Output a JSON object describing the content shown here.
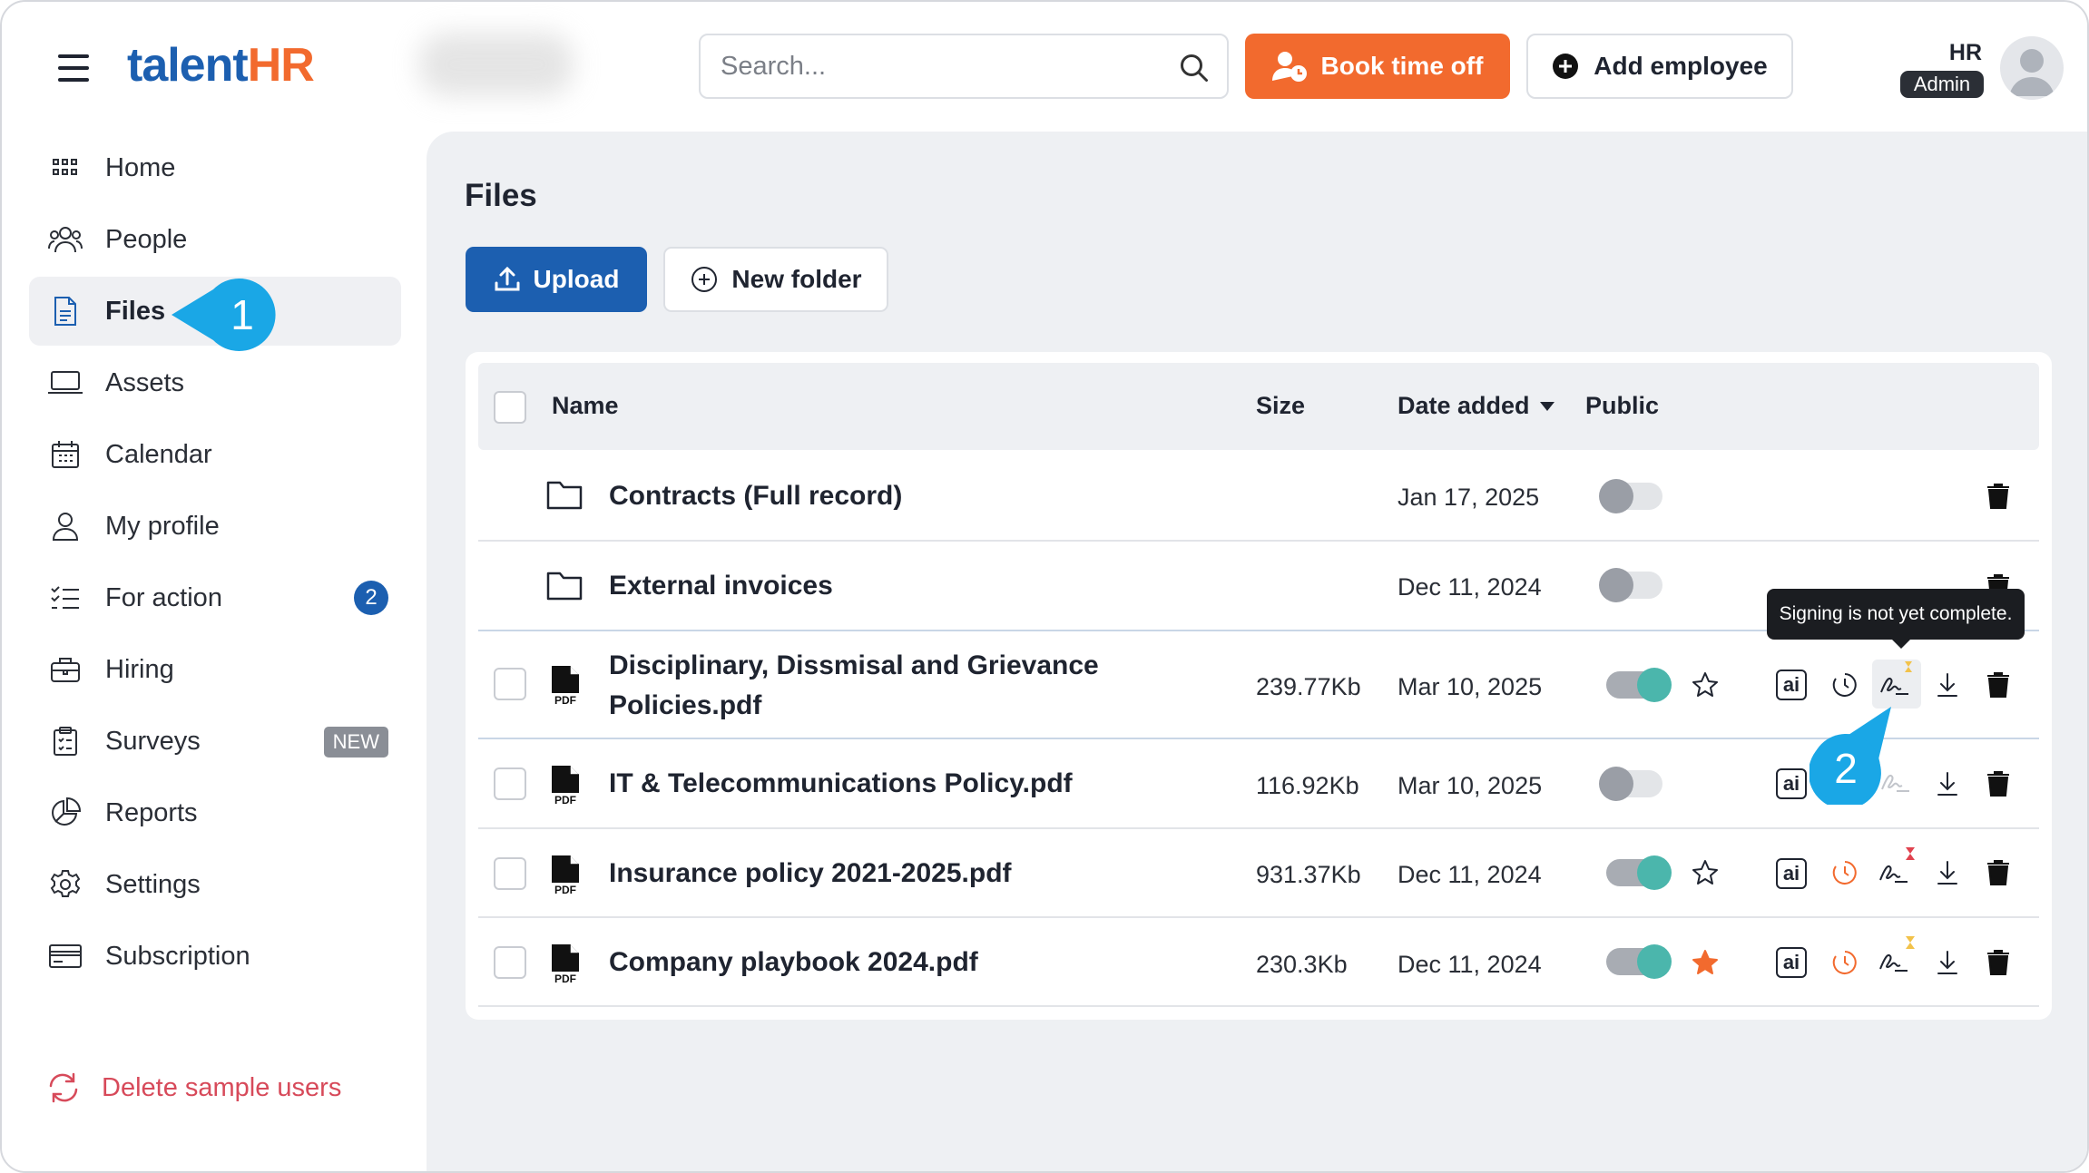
{
  "header": {
    "logo_talent": "talent",
    "logo_hr": "HR",
    "search_placeholder": "Search...",
    "book_time_off": "Book time off",
    "add_employee": "Add employee",
    "user_role_top": "HR",
    "user_role_badge": "Admin"
  },
  "sidebar": {
    "items": [
      {
        "label": "Home",
        "icon": "grid-icon"
      },
      {
        "label": "People",
        "icon": "people-icon"
      },
      {
        "label": "Files",
        "icon": "file-icon",
        "active": true
      },
      {
        "label": "Assets",
        "icon": "laptop-icon"
      },
      {
        "label": "Calendar",
        "icon": "calendar-icon"
      },
      {
        "label": "My profile",
        "icon": "person-icon"
      },
      {
        "label": "For action",
        "icon": "checklist-icon",
        "badge": "2"
      },
      {
        "label": "Hiring",
        "icon": "briefcase-icon"
      },
      {
        "label": "Surveys",
        "icon": "clipboard-icon",
        "tag": "NEW"
      },
      {
        "label": "Reports",
        "icon": "pie-chart-icon"
      },
      {
        "label": "Settings",
        "icon": "gear-icon"
      },
      {
        "label": "Subscription",
        "icon": "card-icon"
      }
    ],
    "delete_sample_users": "Delete sample users"
  },
  "main": {
    "title": "Files",
    "upload_label": "Upload",
    "new_folder_label": "New folder",
    "columns": {
      "name": "Name",
      "size": "Size",
      "date_added": "Date added",
      "public": "Public"
    },
    "rows": [
      {
        "type": "folder",
        "name": "Contracts (Full record)",
        "size": "",
        "date": "Jan 17, 2025",
        "public": false
      },
      {
        "type": "folder",
        "name": "External invoices",
        "size": "",
        "date": "Dec 11, 2024",
        "public": false
      },
      {
        "type": "pdf",
        "name_line1": "Disciplinary, Dissmisal and Grievance",
        "name_line2": "Policies.pdf",
        "size": "239.77Kb",
        "date": "Mar 10, 2025",
        "public": true,
        "starred": false,
        "sign_status": "pending"
      },
      {
        "type": "pdf",
        "name": "IT & Telecommunications Policy.pdf",
        "size": "116.92Kb",
        "date": "Mar 10, 2025",
        "public": false,
        "sign_status": "none"
      },
      {
        "type": "pdf",
        "name": "Insurance policy 2021-2025.pdf",
        "size": "931.37Kb",
        "date": "Dec 11, 2024",
        "public": true,
        "starred": false,
        "sign_status": "expired"
      },
      {
        "type": "pdf",
        "name": "Company playbook 2024.pdf",
        "size": "230.3Kb",
        "date": "Dec 11, 2024",
        "public": true,
        "starred": true,
        "sign_status": "pending"
      }
    ],
    "tooltip": "Signing is not yet complete.",
    "pdf_label": "PDF",
    "ai_label": "ai"
  },
  "callouts": {
    "first": "1",
    "second": "2"
  },
  "colors": {
    "brand_blue": "#1c5fb0",
    "brand_orange": "#f26a2e",
    "toggle_on": "#4bb6ac",
    "callout": "#1aa7e6",
    "danger": "#d74a5a"
  }
}
